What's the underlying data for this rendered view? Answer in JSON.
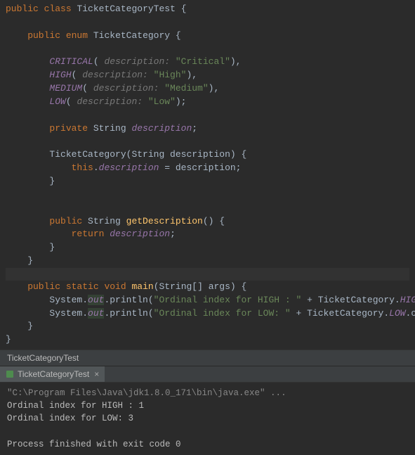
{
  "code": {
    "l1_kw_public": "public",
    "l1_kw_class": "class",
    "l1_class_name": "TicketCategoryTest",
    "l1_brace": " {",
    "l3_kw_public": "    public",
    "l3_kw_enum": "enum",
    "l3_enum_name": "TicketCategory",
    "l3_brace": " {",
    "const1_name": "        CRITICAL",
    "const1_open": "(",
    "hint_desc": " description: ",
    "const1_str": "\"Critical\"",
    "const1_close": "),",
    "const2_name": "        HIGH",
    "const2_open": "(",
    "const2_str": "\"High\"",
    "const2_close": "),",
    "const3_name": "        MEDIUM",
    "const3_open": "(",
    "const3_str": "\"Medium\"",
    "const3_close": "),",
    "const4_name": "        LOW",
    "const4_open": "(",
    "const4_str": "\"Low\"",
    "const4_close": ");",
    "priv_line_kw": "        private",
    "priv_line_type": " String ",
    "priv_line_fld": "description",
    "priv_line_sc": ";",
    "ctor_name": "        TicketCategory",
    "ctor_sig": "(String description) {",
    "ctor_body_this": "            this",
    "ctor_body_dot": ".",
    "ctor_body_fld": "description",
    "ctor_body_assign": " = description;",
    "ctor_close": "        }",
    "get_kw_public": "        public",
    "get_type": " String ",
    "get_name": "getDescription",
    "get_sig": "() {",
    "get_kw_return": "            return",
    "get_fld": " description",
    "get_sc": ";",
    "get_close": "        }",
    "enum_close": "    }",
    "main_kw_public": "    public",
    "main_kw_static": "static",
    "main_kw_void": "void",
    "main_name": " main",
    "main_sig": "(String[] args) {",
    "sout_sys": "        System",
    "sout_dot": ".",
    "sout_out": "out",
    "sout_print": ".println(",
    "sout_str1": "\"Ordinal index for HIGH : \"",
    "sout_plus": " + ",
    "sout_tc": "TicketCategory",
    "sout_high": "HIGH",
    "sout_ord": ".ordinal());",
    "sout_str2": "\"Ordinal index for LOW: \"",
    "sout_low": "LOW",
    "main_close": "    }",
    "class_close": "}"
  },
  "breadcrumb": "TicketCategoryTest",
  "tab": {
    "label": "TicketCategoryTest",
    "close": "×"
  },
  "console": {
    "cmd": "\"C:\\Program Files\\Java\\jdk1.8.0_171\\bin\\java.exe\" ...",
    "out1": "Ordinal index for HIGH : 1",
    "out2": "Ordinal index for LOW: 3",
    "exit": "Process finished with exit code 0"
  }
}
